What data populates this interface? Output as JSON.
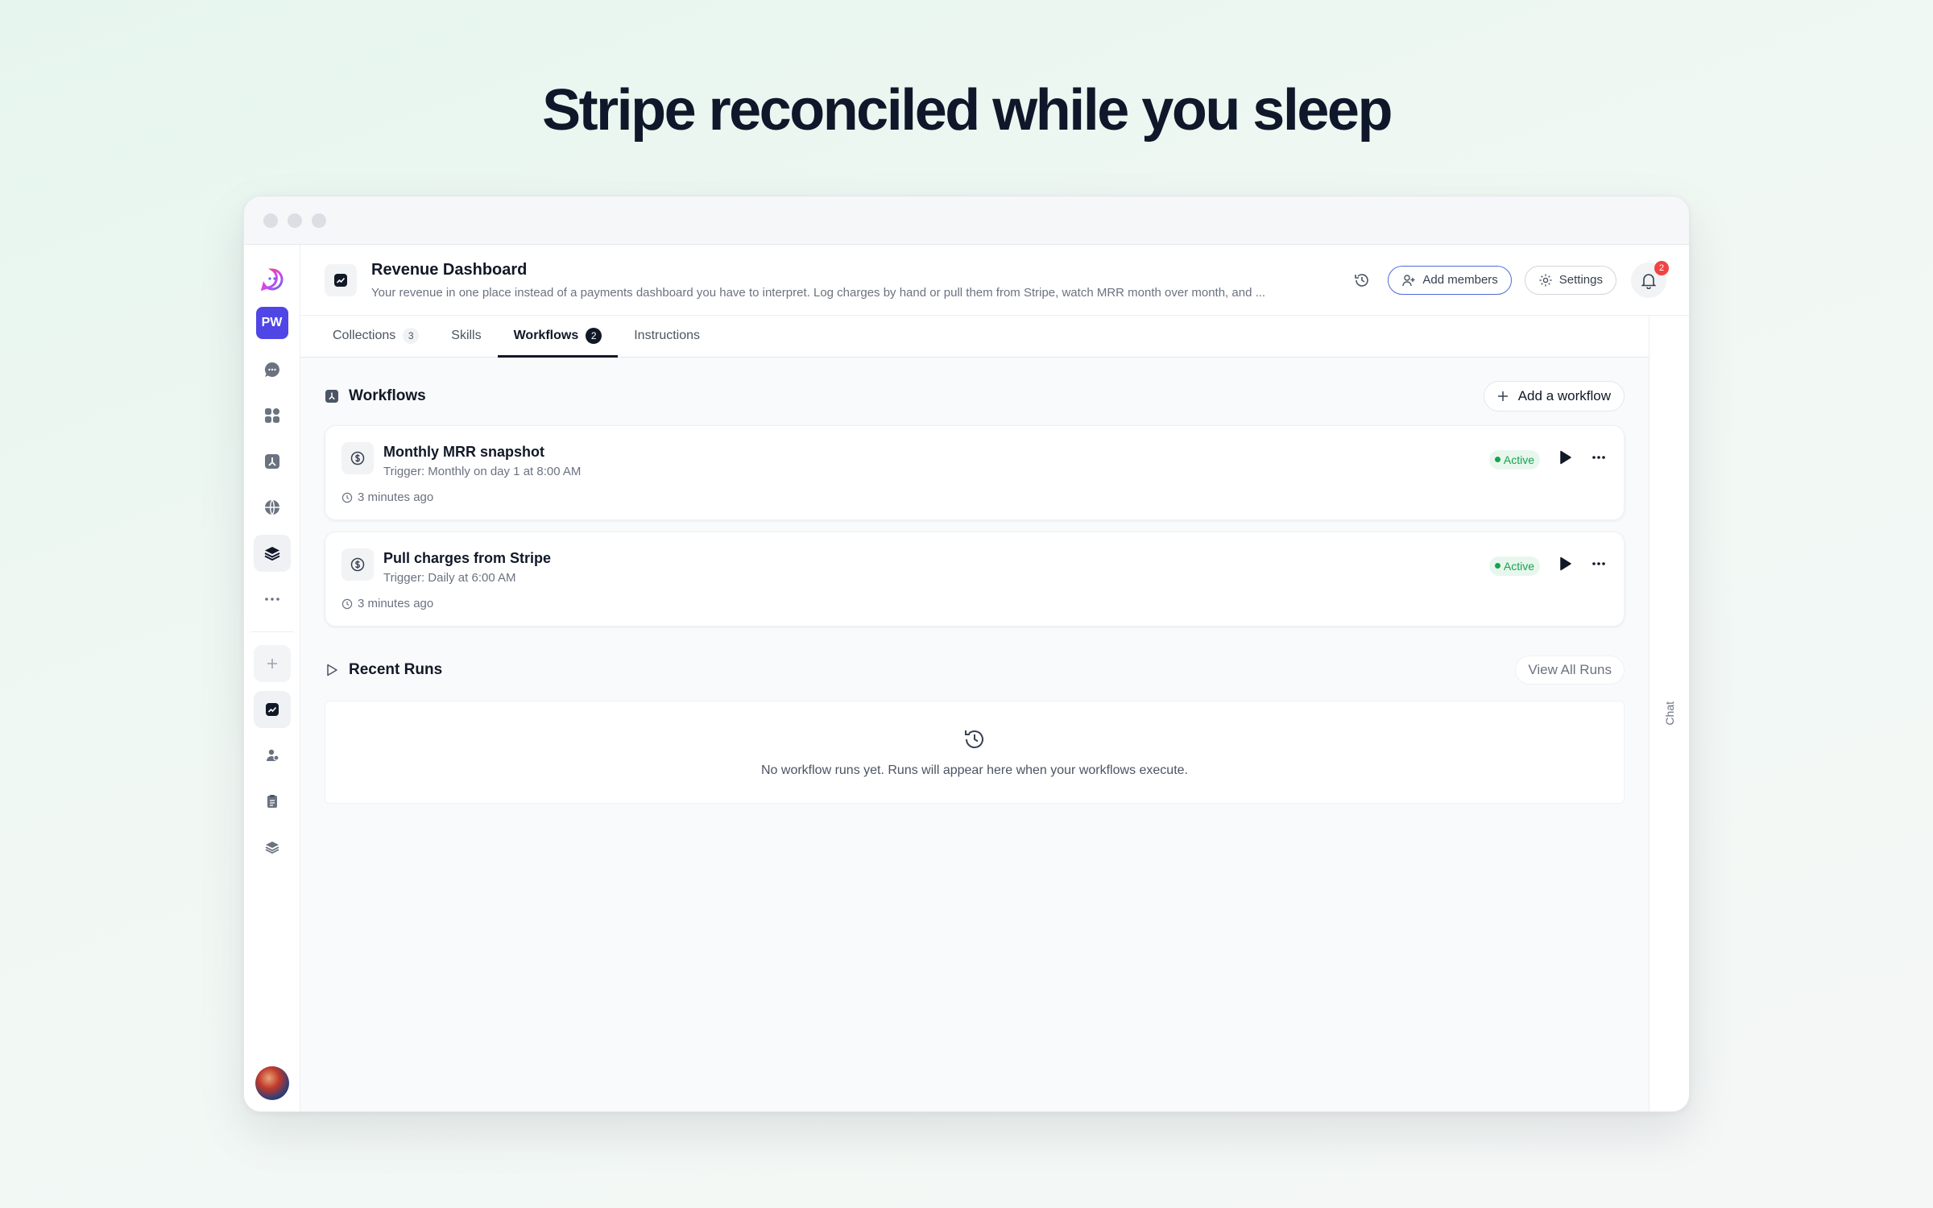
{
  "headline": "Stripe reconciled while you sleep",
  "header": {
    "title": "Revenue Dashboard",
    "description": "Your revenue in one place instead of a payments dashboard you have to interpret. Log charges by hand or pull them from Stripe, watch MRR month over month, and ...",
    "add_members_label": "Add members",
    "settings_label": "Settings",
    "notification_count": "2"
  },
  "sidebar": {
    "workspace_initials": "PW"
  },
  "tabs": [
    {
      "label": "Collections",
      "count": "3"
    },
    {
      "label": "Skills"
    },
    {
      "label": "Workflows",
      "count": "2",
      "active": true
    },
    {
      "label": "Instructions"
    }
  ],
  "workflows_section": {
    "title": "Workflows",
    "add_label": "Add a workflow"
  },
  "workflows": [
    {
      "name": "Monthly MRR snapshot",
      "trigger": "Trigger: Monthly on day 1 at 8:00 AM",
      "time": "3 minutes ago",
      "status": "Active"
    },
    {
      "name": "Pull charges from Stripe",
      "trigger": "Trigger: Daily at 6:00 AM",
      "time": "3 minutes ago",
      "status": "Active"
    }
  ],
  "recent_runs": {
    "title": "Recent Runs",
    "view_all_label": "View All Runs",
    "empty_text": "No workflow runs yet. Runs will appear here when your workflows execute."
  },
  "chat_rail_label": "Chat",
  "colors": {
    "accent": "#4f46e5",
    "active_green": "#16a34a",
    "badge_red": "#ef4444"
  }
}
